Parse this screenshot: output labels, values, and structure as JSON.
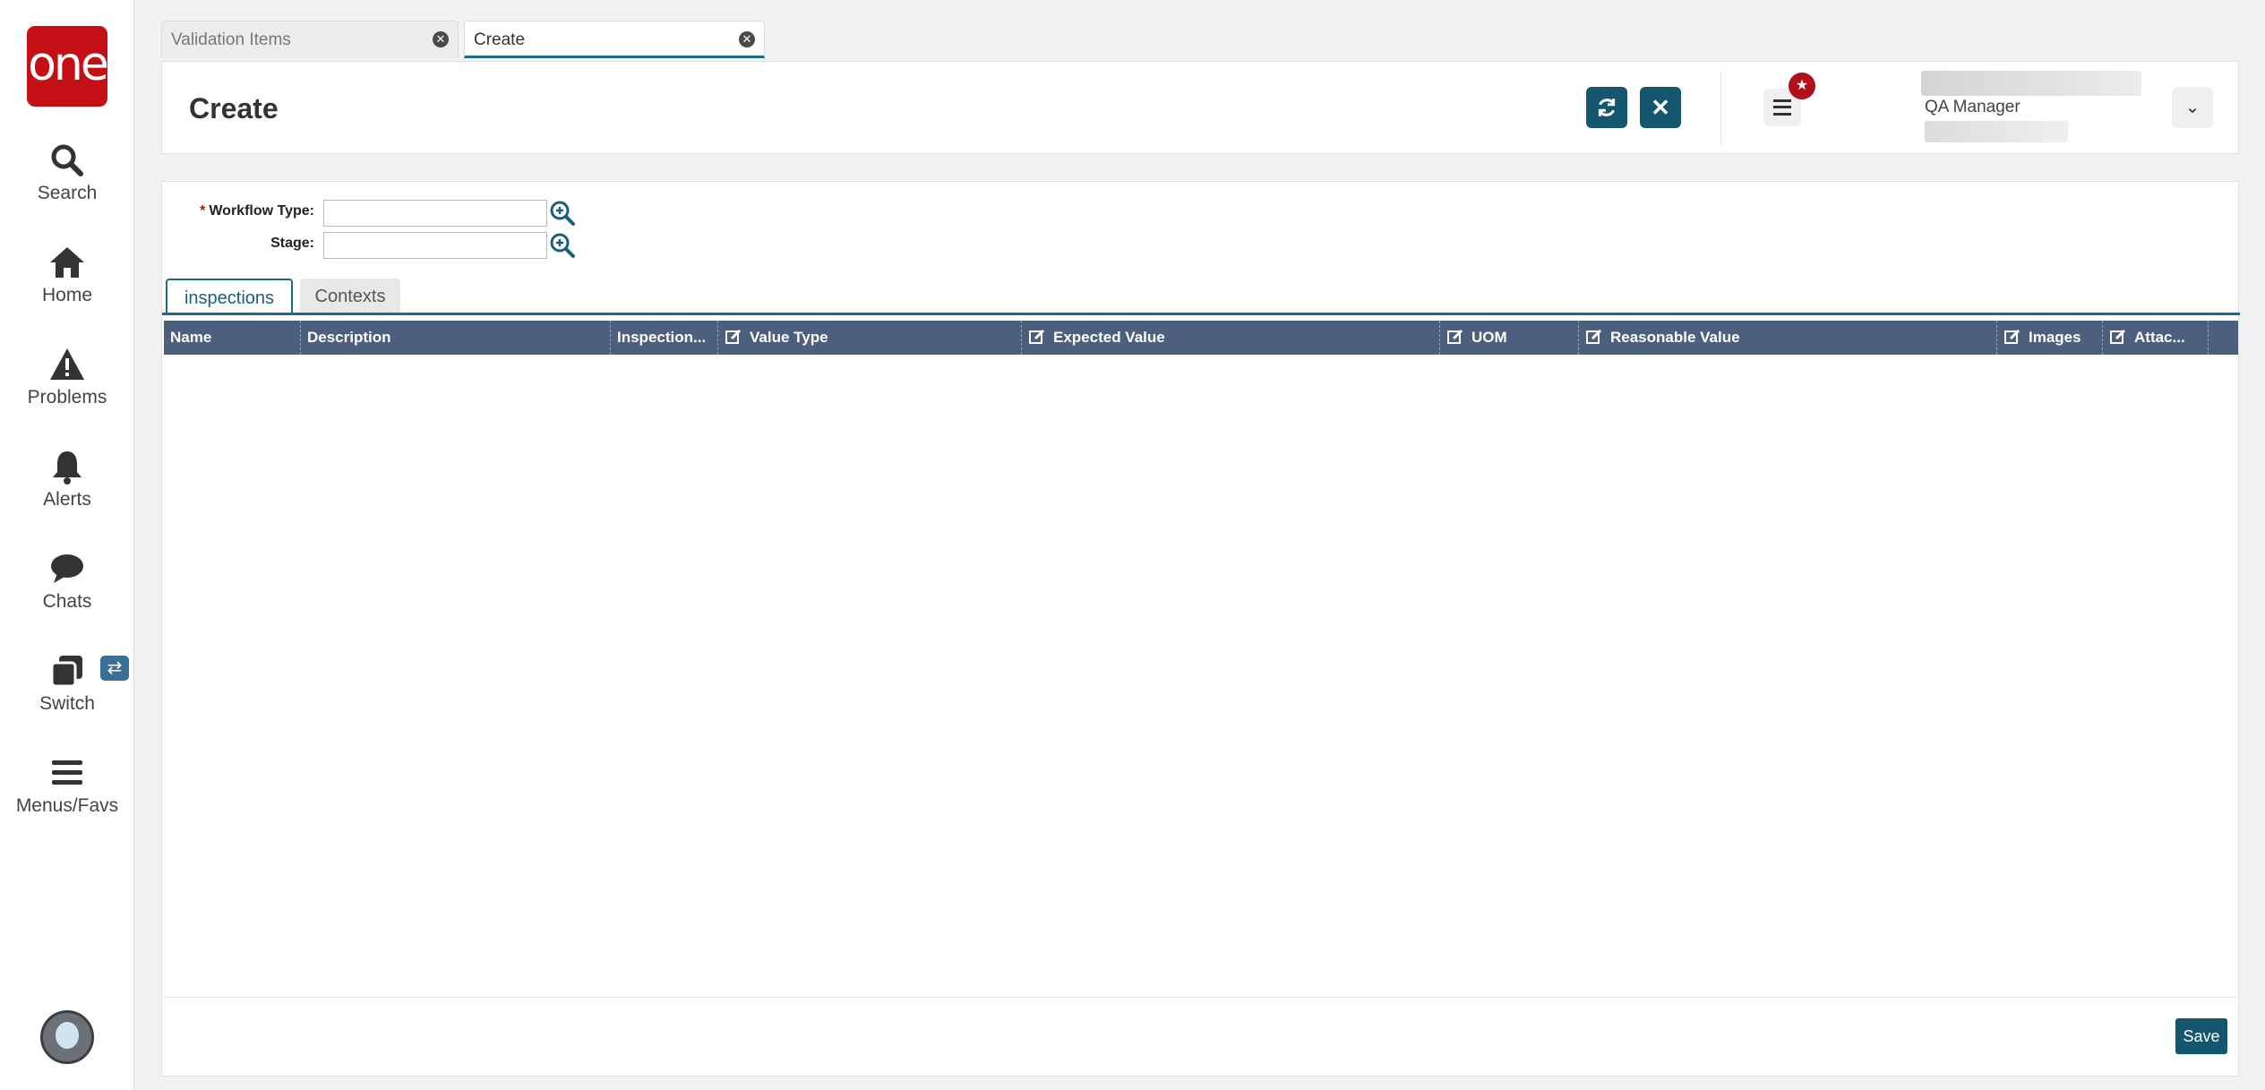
{
  "logo_text": "one",
  "nav": {
    "search": "Search",
    "home": "Home",
    "problems": "Problems",
    "alerts": "Alerts",
    "chats": "Chats",
    "switch": "Switch",
    "menus": "Menus/Favs"
  },
  "tabs": [
    {
      "label": "Validation Items"
    },
    {
      "label": "Create"
    }
  ],
  "header": {
    "title": "Create",
    "user_role": "QA Manager"
  },
  "form": {
    "workflow_type_label": "Workflow Type:",
    "required_mark": "*",
    "stage_label": "Stage:",
    "workflow_type_value": "",
    "stage_value": ""
  },
  "subtabs": {
    "inspections": "inspections",
    "contexts": "Contexts"
  },
  "grid": {
    "columns": [
      "Name",
      "Description",
      "Inspection...",
      "Value Type",
      "Expected Value",
      "UOM",
      "Reasonable Value",
      "Images",
      "Attac..."
    ]
  },
  "footer": {
    "save_label": "Save"
  },
  "colors": {
    "brand": "#c40f14",
    "primary": "#14566d",
    "grid_header": "#4c5f7d"
  }
}
